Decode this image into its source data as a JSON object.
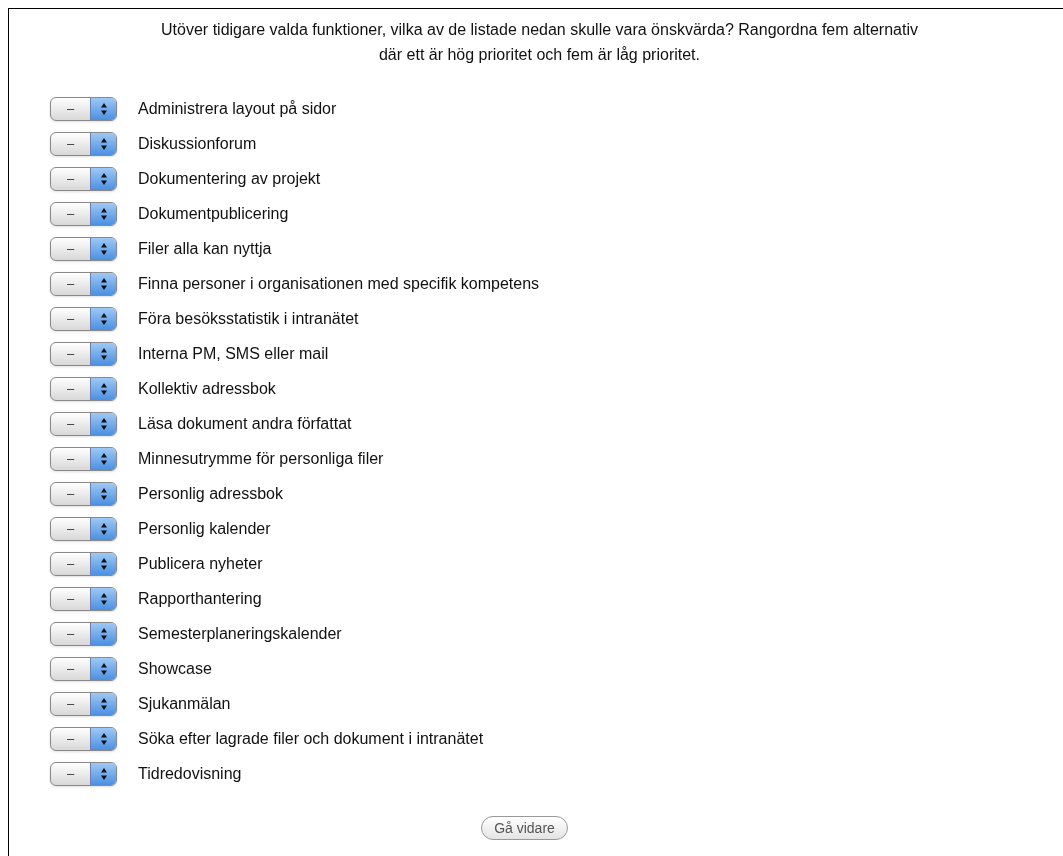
{
  "question": {
    "lines": [
      "Utöver tidigare valda funktioner, vilka av de listade nedan skulle vara önskvärda? Rangordna fem alternativ",
      "där ett är hög prioritet och fem är låg prioritet."
    ]
  },
  "options": [
    {
      "value": "–",
      "label": "Administrera layout på sidor"
    },
    {
      "value": "–",
      "label": "Diskussionforum"
    },
    {
      "value": "–",
      "label": "Dokumentering av projekt"
    },
    {
      "value": "–",
      "label": "Dokumentpublicering"
    },
    {
      "value": "–",
      "label": "Filer alla kan nyttja"
    },
    {
      "value": "–",
      "label": "Finna personer i organisationen med specifik kompetens"
    },
    {
      "value": "–",
      "label": "Föra besöksstatistik i intranätet"
    },
    {
      "value": "–",
      "label": "Interna PM, SMS eller mail"
    },
    {
      "value": "–",
      "label": "Kollektiv adressbok"
    },
    {
      "value": "–",
      "label": "Läsa dokument andra författat"
    },
    {
      "value": "–",
      "label": "Minnesutrymme för personliga filer"
    },
    {
      "value": "–",
      "label": "Personlig adressbok"
    },
    {
      "value": "–",
      "label": "Personlig kalender"
    },
    {
      "value": "–",
      "label": "Publicera nyheter"
    },
    {
      "value": "–",
      "label": "Rapporthantering"
    },
    {
      "value": "–",
      "label": "Semesterplaneringskalender"
    },
    {
      "value": "–",
      "label": "Showcase"
    },
    {
      "value": "–",
      "label": "Sjukanmälan"
    },
    {
      "value": "–",
      "label": "Söka efter lagrade filer och dokument i intranätet"
    },
    {
      "value": "–",
      "label": "Tidredovisning"
    }
  ],
  "button": {
    "label": "Gå vidare"
  }
}
